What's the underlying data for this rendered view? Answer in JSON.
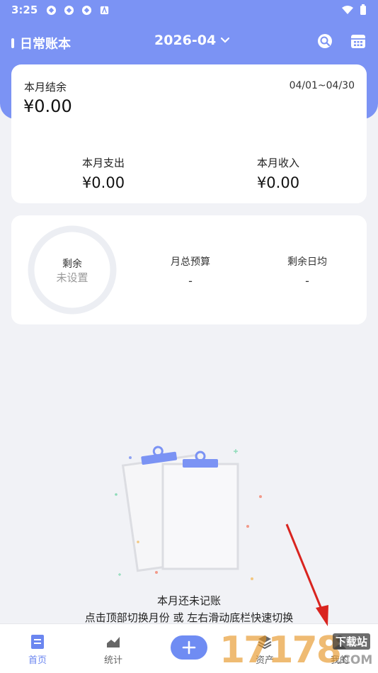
{
  "status": {
    "time": "3:25"
  },
  "topbar": {
    "book_name": "日常账本",
    "month": "2026-04"
  },
  "summary": {
    "balance_label": "本月结余",
    "date_range": "04/01~04/30",
    "balance_value": "¥0.00",
    "expense_label": "本月支出",
    "expense_value": "¥0.00",
    "income_label": "本月收入",
    "income_value": "¥0.00"
  },
  "budget": {
    "remaining_label": "剩余",
    "remaining_value": "未设置",
    "monthly_budget_label": "月总预算",
    "monthly_budget_value": "-",
    "daily_avg_label": "剩余日均",
    "daily_avg_value": "-"
  },
  "empty_state": {
    "title": "本月还未记账",
    "hint": "点击顶部切换月份 或 左右滑动底栏快速切换"
  },
  "nav": {
    "home": "首页",
    "stats": "统计",
    "assets": "资产",
    "mine": "我的"
  },
  "watermark": {
    "text": "17178",
    "sub": "下载站",
    "domain": ".COM"
  },
  "colors": {
    "primary": "#7b93f4",
    "accent": "#6f8cf3",
    "arrow": "#e0302a"
  }
}
